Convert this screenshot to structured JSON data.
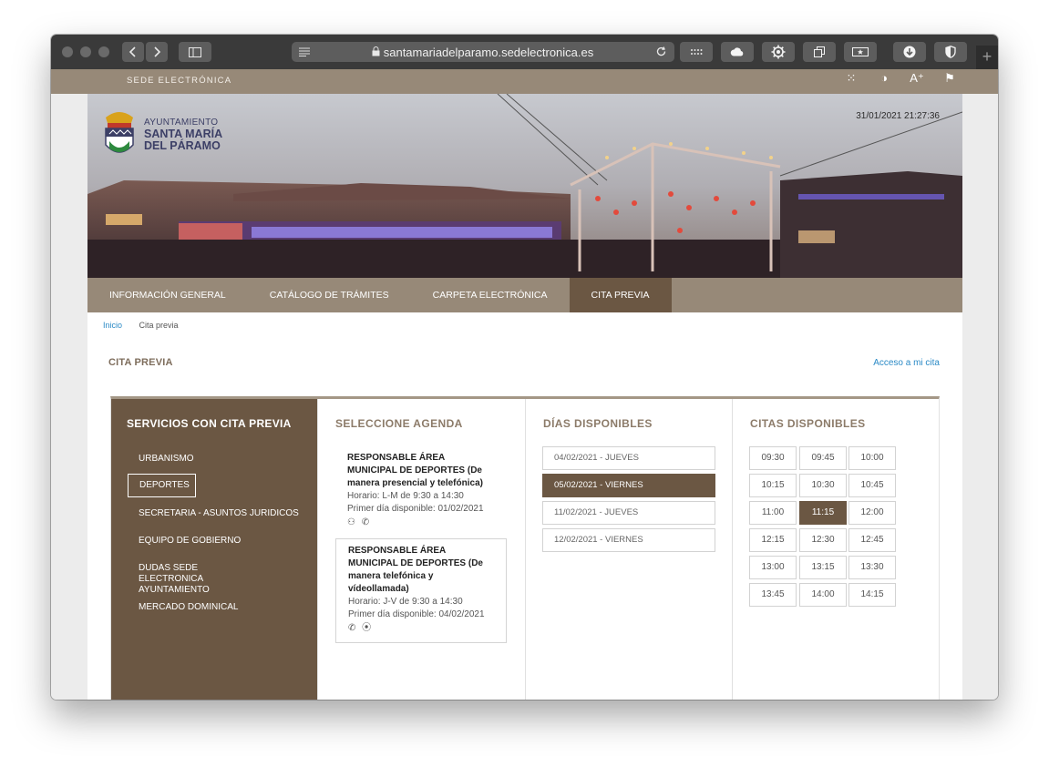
{
  "browser": {
    "url": "santamariadelparamo.sedelectronica.es"
  },
  "site": {
    "sede_label": "SEDE ELECTRÓNICA",
    "logo": {
      "line1": "AYUNTAMIENTO",
      "line2": "SANTA MARÍA",
      "line3": "DEL PÁRAMO"
    },
    "timestamp": "31/01/2021 21:27:36"
  },
  "nav": {
    "items": [
      {
        "label": "INFORMACIÓN GENERAL"
      },
      {
        "label": "CATÁLOGO DE TRÁMITES"
      },
      {
        "label": "CARPETA ELECTRÓNICA"
      },
      {
        "label": "CITA PREVIA"
      }
    ],
    "active": "CITA PREVIA"
  },
  "breadcrumb": {
    "home": "Inicio",
    "current": "Cita previa"
  },
  "page": {
    "title": "CITA PREVIA",
    "access_link": "Acceso a mi cita"
  },
  "services": {
    "title": "SERVICIOS CON CITA PREVIA",
    "items": [
      {
        "label": "URBANISMO"
      },
      {
        "label": "DEPORTES"
      },
      {
        "label": "SECRETARIA - ASUNTOS JURIDICOS"
      },
      {
        "label": "EQUIPO DE GOBIERNO"
      },
      {
        "label": "DUDAS SEDE ELECTRONICA AYUNTAMIENTO"
      },
      {
        "label": "MERCADO DOMINICAL"
      }
    ],
    "selected": "DEPORTES"
  },
  "agenda": {
    "title": "SELECCIONE AGENDA",
    "cards": [
      {
        "name": "RESPONSABLE ÁREA MUNICIPAL DE DEPORTES (De manera presencial y telefónica)",
        "schedule": "Horario: L-M de 9:30 a 14:30",
        "first_day": "Primer día disponible: 01/02/2021",
        "icons": [
          "in-person-icon",
          "phone-icon"
        ]
      },
      {
        "name": "RESPONSABLE ÁREA MUNICIPAL DE DEPORTES (De manera telefónica y vídeollamada)",
        "schedule": "Horario: J-V de 9:30 a 14:30",
        "first_day": "Primer día disponible: 04/02/2021",
        "icons": [
          "phone-icon",
          "location-icon"
        ]
      }
    ]
  },
  "days": {
    "title": "DÍAS DISPONIBLES",
    "items": [
      {
        "label": "04/02/2021 - JUEVES"
      },
      {
        "label": "05/02/2021 - VIERNES"
      },
      {
        "label": "11/02/2021 - JUEVES"
      },
      {
        "label": "12/02/2021 - VIERNES"
      }
    ],
    "selected": "05/02/2021 - VIERNES"
  },
  "slots": {
    "title": "CITAS DISPONIBLES",
    "items": [
      "09:30",
      "09:45",
      "10:00",
      "10:15",
      "10:30",
      "10:45",
      "11:00",
      "11:15",
      "12:00",
      "12:15",
      "12:30",
      "12:45",
      "13:00",
      "13:15",
      "13:30",
      "13:45",
      "14:00",
      "14:15"
    ],
    "selected": "11:15"
  },
  "colors": {
    "brand": "#978978",
    "brand_dark": "#6b5743",
    "link": "#2b8ac6",
    "heading": "#8c7b69"
  }
}
